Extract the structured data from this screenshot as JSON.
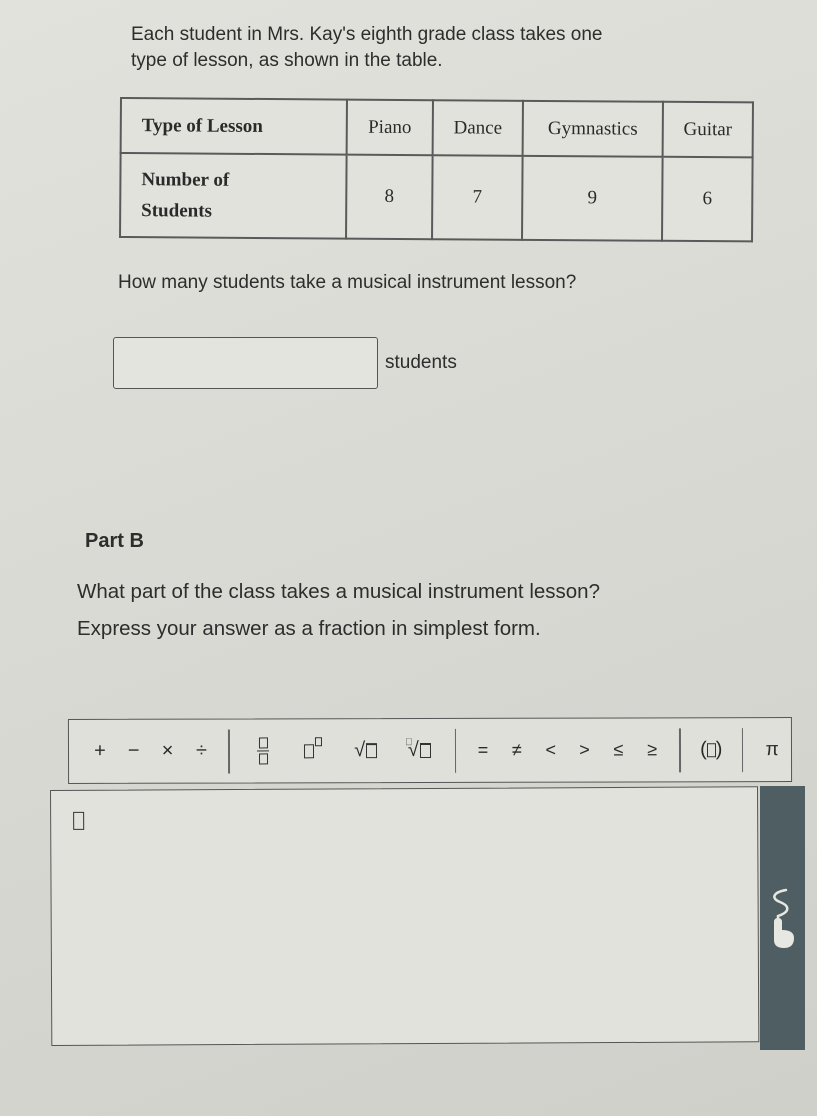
{
  "intro": {
    "line1": "Each student in Mrs. Kay's eighth grade class takes one",
    "line2": "type of lesson, as shown in the table."
  },
  "table": {
    "row_header_1": "Type of Lesson",
    "row_header_2_line1": "Number of",
    "row_header_2_line2": "Students",
    "columns": [
      {
        "lesson": "Piano",
        "students": "8"
      },
      {
        "lesson": "Dance",
        "students": "7"
      },
      {
        "lesson": "Gymnastics",
        "students": "9"
      },
      {
        "lesson": "Guitar",
        "students": "6"
      }
    ]
  },
  "part_a": {
    "question": "How many students take a musical instrument lesson?",
    "answer_value": "",
    "unit": "students"
  },
  "part_b": {
    "title": "Part B",
    "question": "What part of the class takes a musical instrument lesson?",
    "hint": "Express your answer as a fraction in simplest form.",
    "answer_value": ""
  },
  "toolbar": {
    "operators": [
      "+",
      "−",
      "×",
      "÷"
    ],
    "templates": [
      "fraction-template",
      "exponent-template",
      "square-root-template",
      "nth-root-template"
    ],
    "nth_root_index": "⎕",
    "relations": [
      "=",
      "≠",
      "<",
      ">",
      "≤",
      "≥"
    ],
    "parentheses_open": "(",
    "parentheses_close": ")",
    "pi": "π"
  },
  "side_panel": {
    "icon": "touch-gesture-icon",
    "color": "#4f5e62"
  }
}
